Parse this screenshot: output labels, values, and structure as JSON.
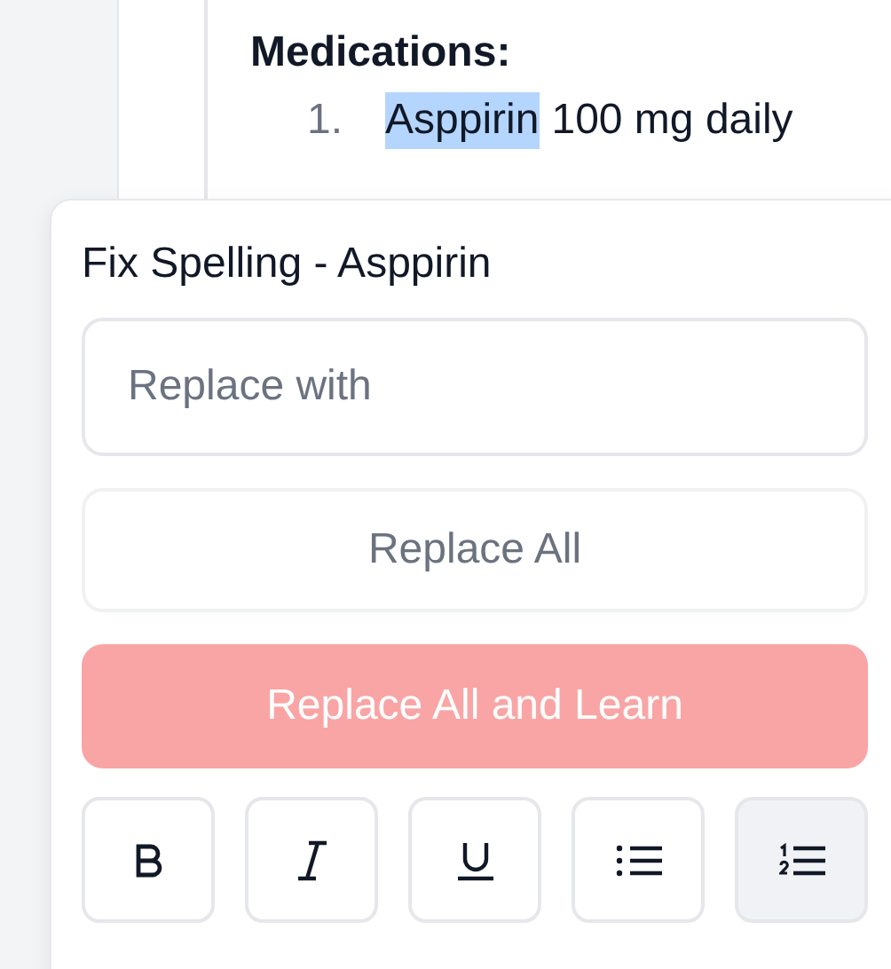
{
  "document": {
    "heading": "Medications:",
    "items": [
      {
        "number": "1.",
        "word": "Asppirin",
        "highlighted": true,
        "rest": "100 mg daily"
      }
    ]
  },
  "spelling_popup": {
    "title": "Fix Spelling - Asppirin",
    "replace_field": {
      "placeholder": "Replace with"
    },
    "buttons": [
      {
        "kind": "secondary",
        "label": "Replace All",
        "disabled": true
      },
      {
        "kind": "primary",
        "label": "Replace All and Learn",
        "disabled": true
      }
    ],
    "toolbar": [
      {
        "kind": "bold",
        "selected": false
      },
      {
        "kind": "italic",
        "selected": false
      },
      {
        "kind": "underline",
        "selected": false
      },
      {
        "kind": "bullet-list",
        "selected": false
      },
      {
        "kind": "numbered-list",
        "selected": true
      }
    ]
  }
}
